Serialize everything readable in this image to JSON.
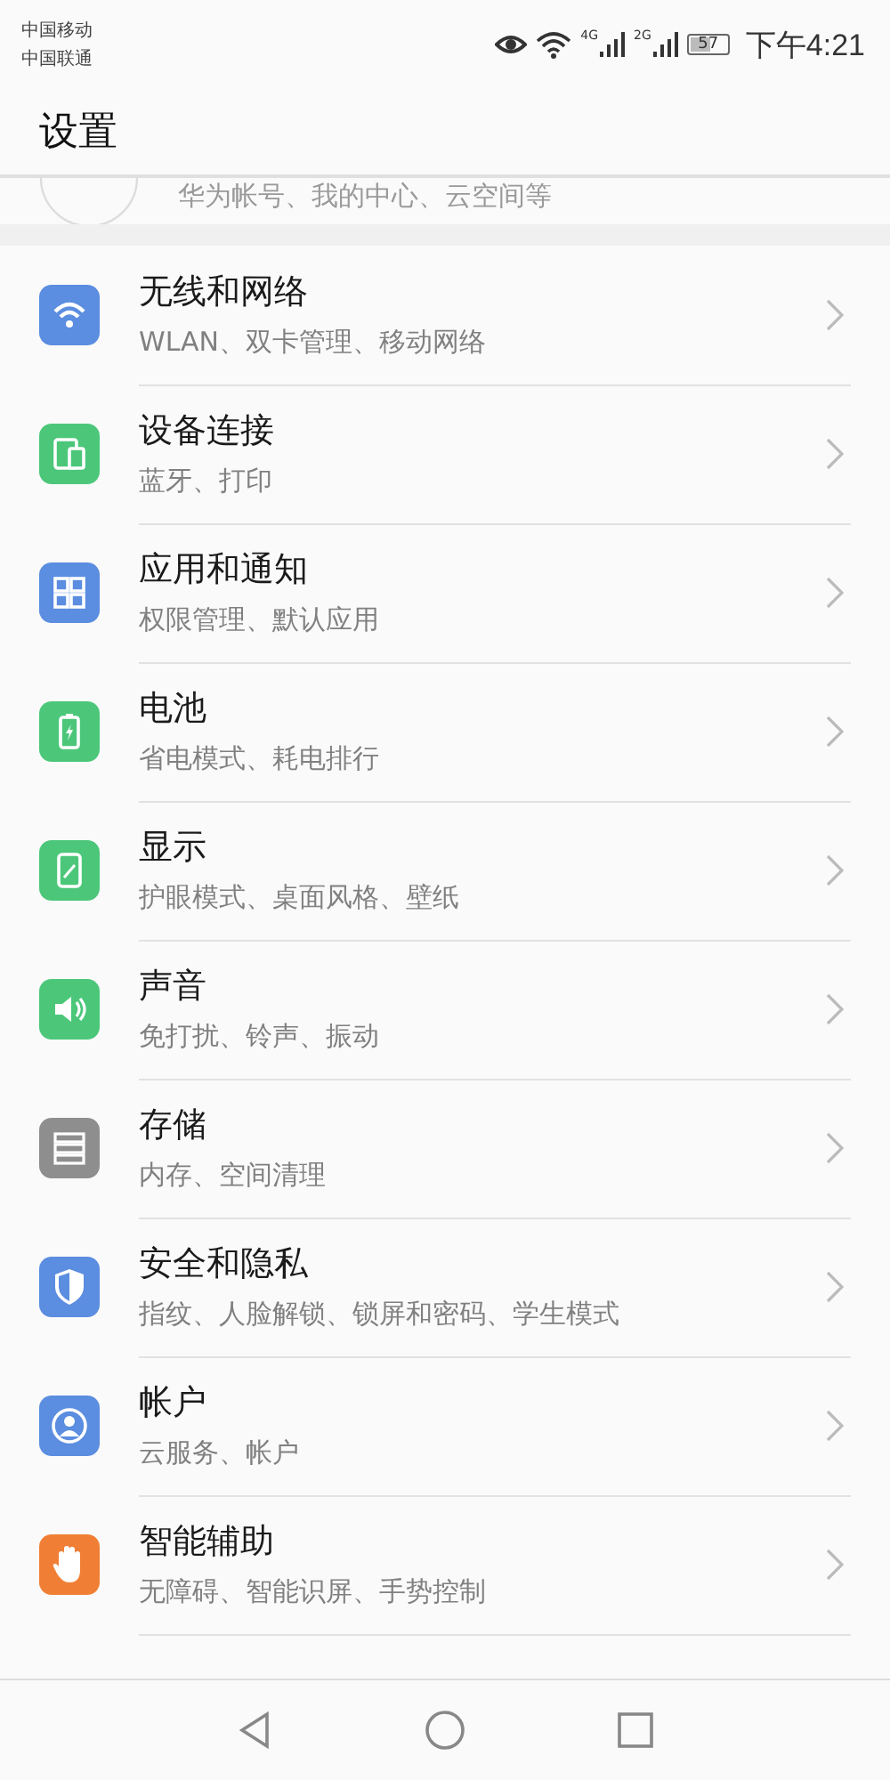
{
  "status_bar": {
    "carriers": [
      "中国移动",
      "中国联通"
    ],
    "network_labels": [
      "4G",
      "2G"
    ],
    "battery": {
      "level": 0.57,
      "reading": "57"
    },
    "time": "下午4:21"
  },
  "header": {
    "title": "设置"
  },
  "account": {
    "subtitle": "华为帐号、我的中心、云空间等"
  },
  "items": [
    {
      "kind": "wifi",
      "color": "#5b8de0",
      "title": "无线和网络",
      "subtitle": "WLAN、双卡管理、移动网络"
    },
    {
      "kind": "devices",
      "color": "#4cc77a",
      "title": "设备连接",
      "subtitle": "蓝牙、打印"
    },
    {
      "kind": "apps",
      "color": "#5b8de0",
      "title": "应用和通知",
      "subtitle": "权限管理、默认应用"
    },
    {
      "kind": "battery",
      "color": "#4cc77a",
      "title": "电池",
      "subtitle": "省电模式、耗电排行"
    },
    {
      "kind": "display",
      "color": "#4cc77a",
      "title": "显示",
      "subtitle": "护眼模式、桌面风格、壁纸"
    },
    {
      "kind": "sound",
      "color": "#4cc77a",
      "title": "声音",
      "subtitle": "免打扰、铃声、振动"
    },
    {
      "kind": "storage",
      "color": "#8e8e8e",
      "title": "存储",
      "subtitle": "内存、空间清理"
    },
    {
      "kind": "security",
      "color": "#5b8de0",
      "title": "安全和隐私",
      "subtitle": "指纹、人脸解锁、锁屏和密码、学生模式"
    },
    {
      "kind": "account",
      "color": "#5b8de0",
      "title": "帐户",
      "subtitle": "云服务、帐户"
    },
    {
      "kind": "hand",
      "color": "#f07f35",
      "title": "智能辅助",
      "subtitle": "无障碍、智能识屏、手势控制"
    }
  ]
}
